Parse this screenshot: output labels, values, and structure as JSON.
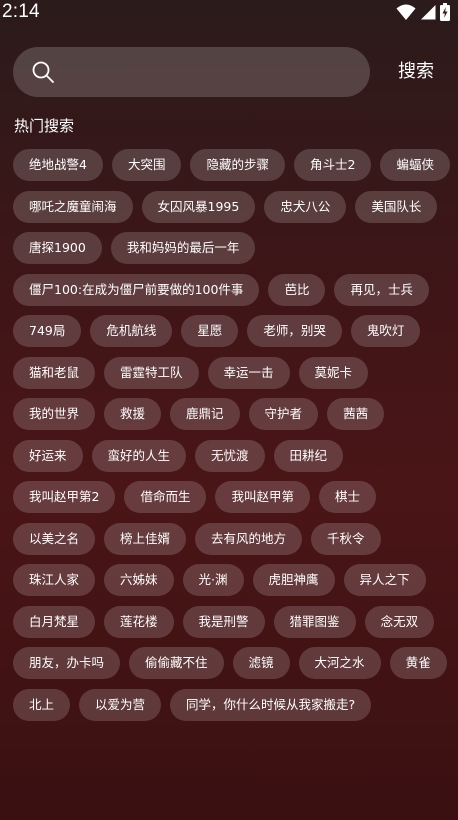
{
  "status_bar": {
    "time": "2:14",
    "icons": [
      "wifi-icon",
      "cellular-signal-icon",
      "battery-charging-icon"
    ]
  },
  "search": {
    "placeholder": "",
    "value": "",
    "button_label": "搜索"
  },
  "hot_search": {
    "title": "热门搜索",
    "items": [
      "绝地战警4",
      "大突围",
      "隐藏的步骤",
      "角斗士2",
      "蝙蝠侠",
      "哪吒之魔童闹海",
      "女囚风暴1995",
      "忠犬八公",
      "美国队长",
      "唐探1900",
      "我和妈妈的最后一年",
      "僵尸100:在成为僵尸前要做的100件事",
      "芭比",
      "再见，士兵",
      "749局",
      "危机航线",
      "星愿",
      "老师，别哭",
      "鬼吹灯",
      "猫和老鼠",
      "雷霆特工队",
      "幸运一击",
      "莫妮卡",
      "我的世界",
      "救援",
      "鹿鼎记",
      "守护者",
      "茜茜",
      "好运来",
      "蛮好的人生",
      "无忧渡",
      "田耕纪",
      "我叫赵甲第2",
      "借命而生",
      "我叫赵甲第",
      "棋士",
      "以美之名",
      "榜上佳婿",
      "去有风的地方",
      "千秋令",
      "珠江人家",
      "六姊妹",
      "光·渊",
      "虎胆神鹰",
      "异人之下",
      "白月梵星",
      "莲花楼",
      "我是刑警",
      "猎罪图鉴",
      "念无双",
      "朋友，办卡吗",
      "偷偷藏不住",
      "滤镜",
      "大河之水",
      "黄雀",
      "北上",
      "以爱为营",
      "同学，你什么时候从我家搬走?"
    ]
  },
  "colors": {
    "background_top": "#2b1b1b",
    "background_mid": "#4a1517",
    "chip_background": "rgba(255,255,255,0.17)",
    "text": "#ffffff"
  }
}
